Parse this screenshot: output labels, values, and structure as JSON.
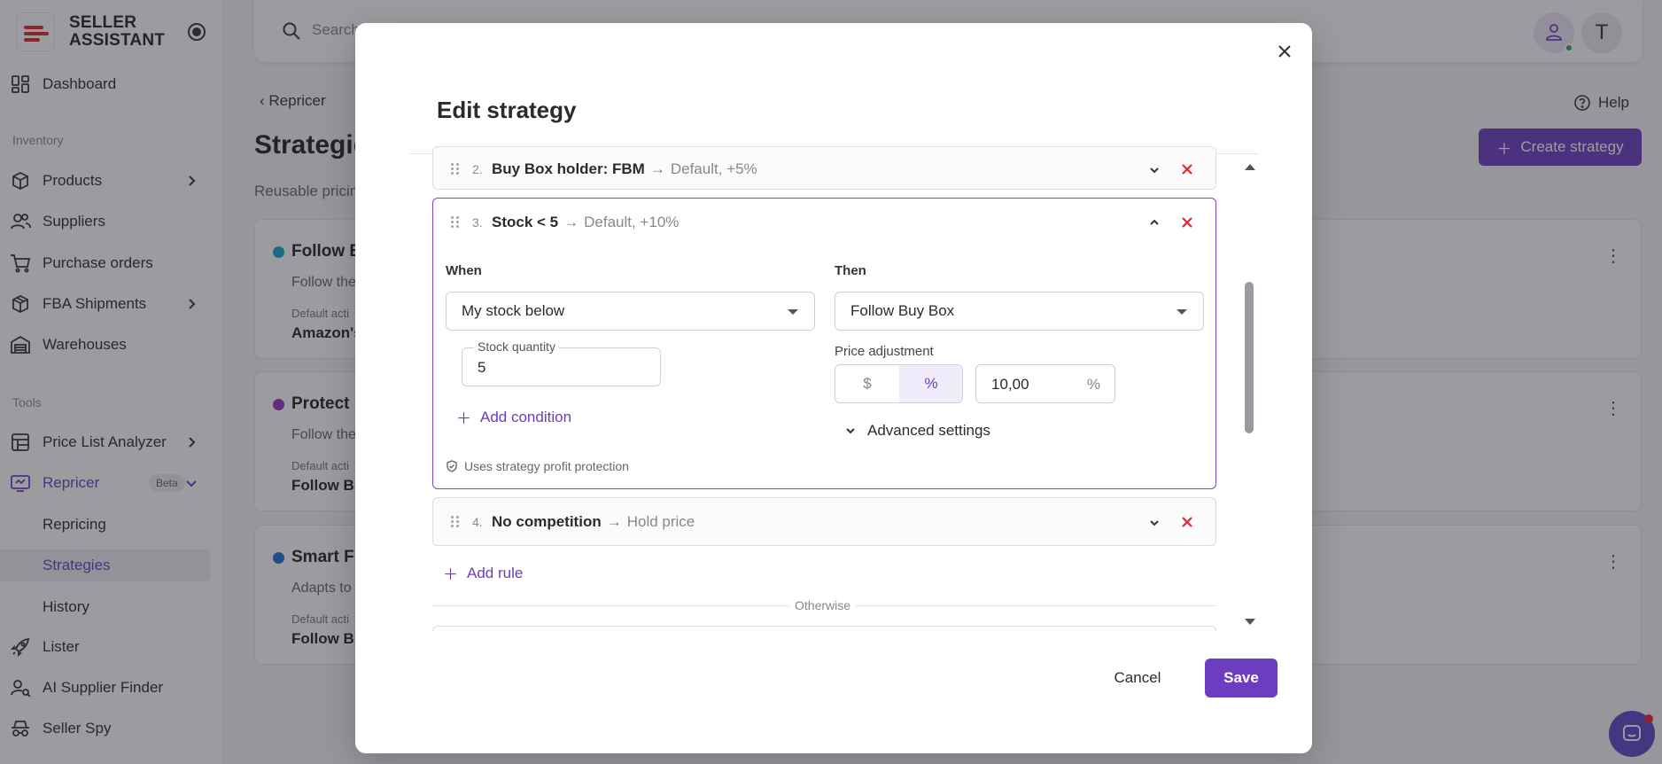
{
  "sidebar": {
    "brand_line1": "SELLER",
    "brand_line2": "ASSISTANT",
    "items": {
      "dashboard": "Dashboard",
      "products": "Products",
      "suppliers": "Suppliers",
      "purchase_orders": "Purchase orders",
      "fba_shipments": "FBA Shipments",
      "warehouses": "Warehouses",
      "price_list_analyzer": "Price List Analyzer",
      "repricer": "Repricer",
      "repricing": "Repricing",
      "strategies": "Strategies",
      "history": "History",
      "lister": "Lister",
      "ai_supplier_finder": "AI Supplier Finder",
      "seller_spy": "Seller Spy"
    },
    "sections": {
      "inventory": "Inventory",
      "tools": "Tools"
    },
    "beta_badge": "Beta",
    "active_item": "Strategies"
  },
  "topbar": {
    "search_placeholder": "Search",
    "avatar_initial": "T"
  },
  "main": {
    "back_link": "Repricer",
    "title": "Strategie",
    "subtitle": "Reusable pricin",
    "help": "Help",
    "create_button": "Create strategy",
    "cards": [
      {
        "title": "Follow B",
        "desc": "Follow the",
        "default_label": "Default acti",
        "default_value": "Amazon's",
        "color": "#0ea5c6"
      },
      {
        "title": "Protect P",
        "desc": "Follow the",
        "default_label": "Default acti",
        "default_value": "Follow Bu",
        "color": "#9b2ec0"
      },
      {
        "title": "Smart FB",
        "desc": "Adapts to",
        "default_label": "Default acti",
        "default_value": "Follow Bu",
        "color": "#1f6fd6"
      }
    ]
  },
  "modal": {
    "title": "Edit strategy",
    "rules": [
      {
        "num": "2.",
        "condition": "Buy Box holder: FBM",
        "arrow": "→",
        "action": "Default, +5%"
      },
      {
        "num": "3.",
        "condition": "Stock < 5",
        "arrow": "→",
        "action": "Default, +10%"
      },
      {
        "num": "4.",
        "condition": "No competition",
        "arrow": "→",
        "action": "Hold price"
      }
    ],
    "editor": {
      "when_label": "When",
      "then_label": "Then",
      "when_select": "My stock below",
      "then_select": "Follow Buy Box",
      "stock_quantity_label": "Stock quantity",
      "stock_quantity_value": "5",
      "price_adjustment_label": "Price adjustment",
      "unit_dollar": "$",
      "unit_percent": "%",
      "adjustment_value": "10,00",
      "adjustment_suffix": "%",
      "add_condition": "Add condition",
      "advanced_settings": "Advanced settings",
      "profit_protection": "Uses strategy profit protection"
    },
    "add_rule": "Add rule",
    "otherwise": "Otherwise",
    "cancel": "Cancel",
    "save": "Save"
  },
  "colors": {
    "accent": "#6c3cc1",
    "danger": "#e1262d",
    "success": "#2ea44f"
  }
}
